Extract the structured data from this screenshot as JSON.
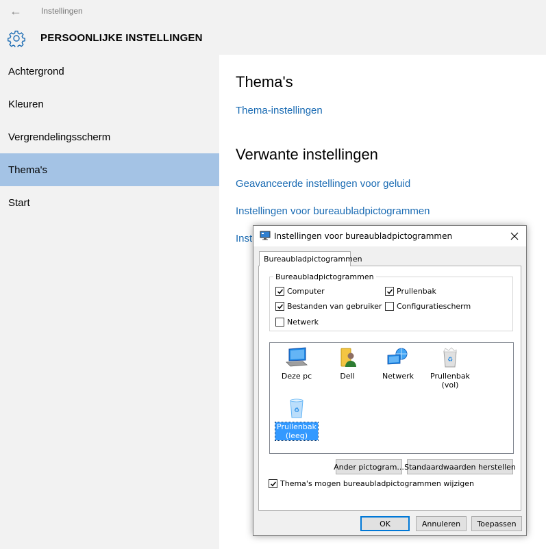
{
  "window": {
    "app_title": "Instellingen",
    "page_title": "PERSOONLIJKE INSTELLINGEN"
  },
  "colors": {
    "accent_link": "#1a6bb3",
    "nav_selected": "#a4c3e5",
    "sidebar_bg": "#f2f2f2",
    "icon_selection": "#3399ff"
  },
  "sidebar": {
    "items": [
      {
        "label": "Achtergrond",
        "active": false
      },
      {
        "label": "Kleuren",
        "active": false
      },
      {
        "label": "Vergrendelingsscherm",
        "active": false
      },
      {
        "label": "Thema's",
        "active": true
      },
      {
        "label": "Start",
        "active": false
      }
    ]
  },
  "content": {
    "themes_heading": "Thema's",
    "themes_settings_link": "Thema-instellingen",
    "related_heading": "Verwante instellingen",
    "related_links": [
      "Geavanceerde instellingen voor geluid",
      "Instellingen voor bureaubladpictogrammen",
      "Inst"
    ]
  },
  "dialog": {
    "title": "Instellingen voor bureaubladpictogrammen",
    "tab_label": "Bureaubladpictogrammen",
    "group_label": "Bureaubladpictogrammen",
    "checkboxes": [
      {
        "label": "Computer",
        "checked": true
      },
      {
        "label": "Prullenbak",
        "checked": true
      },
      {
        "label": "Bestanden van gebruiker",
        "checked": true
      },
      {
        "label": "Configuratiescherm",
        "checked": false
      },
      {
        "label": "Netwerk",
        "checked": false
      }
    ],
    "icons": [
      {
        "label": "Deze pc",
        "icon": "computer-icon",
        "selected": false
      },
      {
        "label": "Dell",
        "icon": "user-folder-icon",
        "selected": false
      },
      {
        "label": "Netwerk",
        "icon": "network-icon",
        "selected": false
      },
      {
        "label_line1": "Prullenbak",
        "label_line2": "(vol)",
        "icon": "recycle-bin-full-icon",
        "selected": false
      },
      {
        "label_line1": "Prullenbak",
        "label_line2": "(leeg)",
        "icon": "recycle-bin-empty-icon",
        "selected": true
      }
    ],
    "change_icon_button": "Ander pictogram...",
    "restore_defaults_button": "Standaardwaarden herstellen",
    "allow_themes_checkbox": {
      "label": "Thema's mogen bureaubladpictogrammen wijzigen",
      "checked": true
    },
    "ok_button": "OK",
    "cancel_button": "Annuleren",
    "apply_button": "Toepassen"
  }
}
